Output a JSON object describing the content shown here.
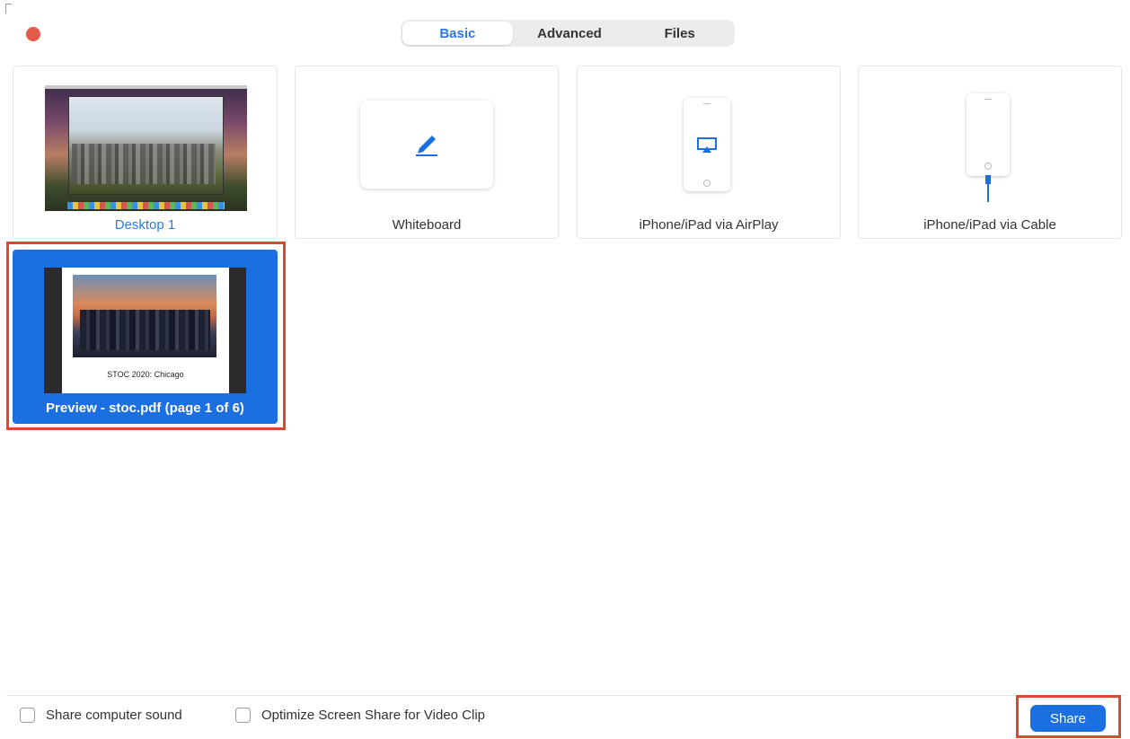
{
  "tabs": [
    {
      "label": "Basic",
      "active": true
    },
    {
      "label": "Advanced",
      "active": false
    },
    {
      "label": "Files",
      "active": false
    }
  ],
  "sources": {
    "desktop": {
      "label": "Desktop 1",
      "icon": "desktop-screenshot-thumbnail"
    },
    "whiteboard": {
      "label": "Whiteboard",
      "icon": "pencil-icon"
    },
    "airplay": {
      "label": "iPhone/iPad via AirPlay",
      "icon": "airplay-icon"
    },
    "cable": {
      "label": "iPhone/iPad via Cable",
      "icon": "cable-icon"
    }
  },
  "selected_window": {
    "label": "Preview - stoc.pdf (page 1 of 6)",
    "page_caption": "STOC 2020: Chicago"
  },
  "options": {
    "share_sound": "Share computer sound",
    "optimize_video": "Optimize Screen Share for Video Clip"
  },
  "actions": {
    "share": "Share"
  },
  "colors": {
    "accent": "#1b6fe0",
    "highlight_outline": "#d9482f",
    "close_button": "#e55a4a"
  }
}
